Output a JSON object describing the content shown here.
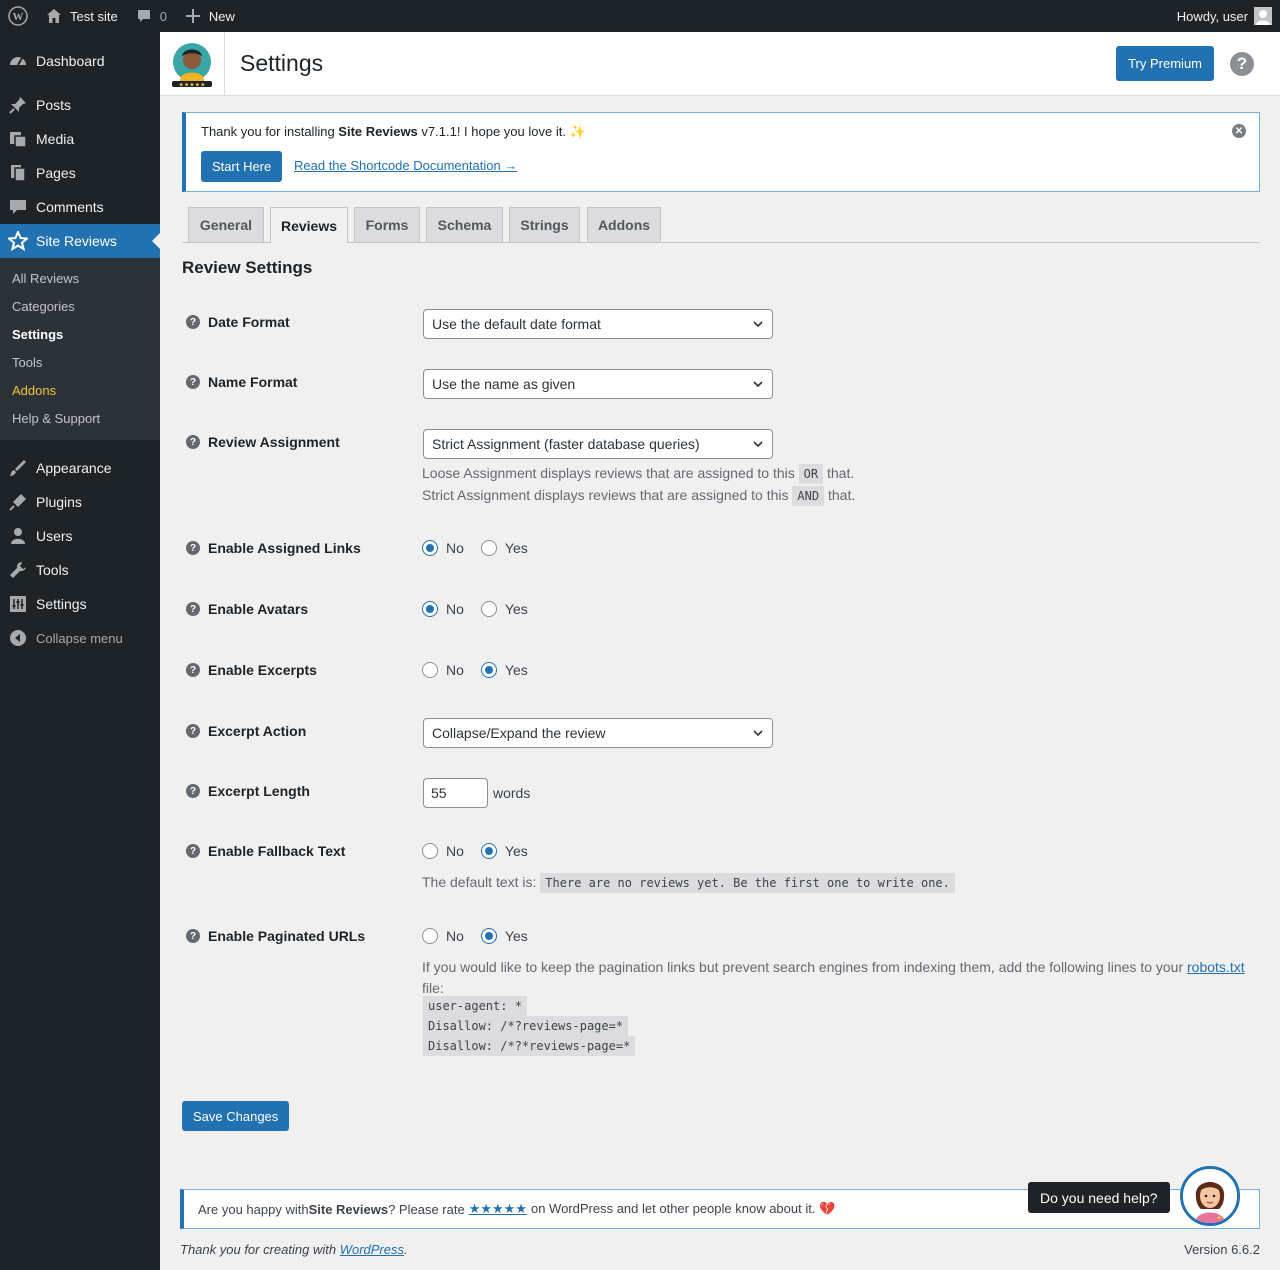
{
  "adminbar": {
    "site_name": "Test site",
    "comments_count": "0",
    "new_label": "New",
    "howdy": "Howdy, user"
  },
  "sidebar": {
    "items_top": [
      {
        "label": "Dashboard",
        "icon": "dashboard-icon"
      },
      {
        "label": "Posts",
        "icon": "pin-icon"
      },
      {
        "label": "Media",
        "icon": "media-icon"
      },
      {
        "label": "Pages",
        "icon": "pages-icon"
      },
      {
        "label": "Comments",
        "icon": "comment-icon"
      },
      {
        "label": "Site Reviews",
        "icon": "star-icon"
      }
    ],
    "submenu": [
      "All Reviews",
      "Categories",
      "Settings",
      "Tools",
      "Addons",
      "Help & Support"
    ],
    "items_bottom": [
      {
        "label": "Appearance",
        "icon": "brush-icon"
      },
      {
        "label": "Plugins",
        "icon": "plugin-icon"
      },
      {
        "label": "Users",
        "icon": "user-icon"
      },
      {
        "label": "Tools",
        "icon": "wrench-icon"
      },
      {
        "label": "Settings",
        "icon": "settings-icon"
      }
    ],
    "collapse": "Collapse menu"
  },
  "header": {
    "title": "Settings",
    "try_premium": "Try Premium",
    "help": "?"
  },
  "notice": {
    "text_before": "Thank you for installing ",
    "plugin_name": "Site Reviews",
    "text_after": " v7.1.1! I hope you love it. ✨",
    "start_button": "Start Here",
    "doc_link": "Read the Shortcode Documentation →"
  },
  "tabs": [
    "General",
    "Reviews",
    "Forms",
    "Schema",
    "Strings",
    "Addons"
  ],
  "active_tab": "Reviews",
  "section_title": "Review Settings",
  "fields": {
    "date_format": {
      "label": "Date Format",
      "value": "Use the default date format"
    },
    "name_format": {
      "label": "Name Format",
      "value": "Use the name as given"
    },
    "review_assignment": {
      "label": "Review Assignment",
      "value": "Strict Assignment (faster database queries)",
      "desc1_before": "Loose Assignment displays reviews that are assigned to this",
      "desc1_code": "OR",
      "desc1_after": "that.",
      "desc2_before": "Strict Assignment displays reviews that are assigned to this",
      "desc2_code": "AND",
      "desc2_after": "that."
    },
    "assigned_links": {
      "label": "Enable Assigned Links",
      "selected": "No"
    },
    "avatars": {
      "label": "Enable Avatars",
      "selected": "No"
    },
    "excerpts": {
      "label": "Enable Excerpts",
      "selected": "Yes"
    },
    "excerpt_action": {
      "label": "Excerpt Action",
      "value": "Collapse/Expand the review"
    },
    "excerpt_length": {
      "label": "Excerpt Length",
      "value": "55",
      "unit": "words"
    },
    "fallback_text": {
      "label": "Enable Fallback Text",
      "selected": "Yes",
      "desc_before": "The default text is:",
      "desc_code": "There are no reviews yet. Be the first one to write one."
    },
    "paginated_urls": {
      "label": "Enable Paginated URLs",
      "selected": "Yes",
      "desc_before": "If you would like to keep the pagination links but prevent search engines from indexing them, add the following lines to your",
      "desc_link": "robots.txt",
      "desc_after": "file:",
      "code_lines": [
        "user-agent: *",
        "Disallow: /*?reviews-page=*",
        "Disallow: /*?*reviews-page=*"
      ]
    }
  },
  "radio_labels": {
    "no": "No",
    "yes": "Yes"
  },
  "save_button": "Save Changes",
  "rate_notice": {
    "before": "Are you happy with ",
    "plugin_name": "Site Reviews",
    "middle": "? Please rate",
    "stars": "★★★★★",
    "after": "on WordPress and let other people know about it. 💔"
  },
  "footer": {
    "left_before": "Thank you for creating with",
    "left_link": "WordPress",
    "left_after": ".",
    "version": "Version 6.6.2"
  },
  "help_bubble": "Do you need help?",
  "colors": {
    "accent": "#2271b1",
    "sidebar": "#1d2327",
    "addons": "#f0c33c"
  }
}
